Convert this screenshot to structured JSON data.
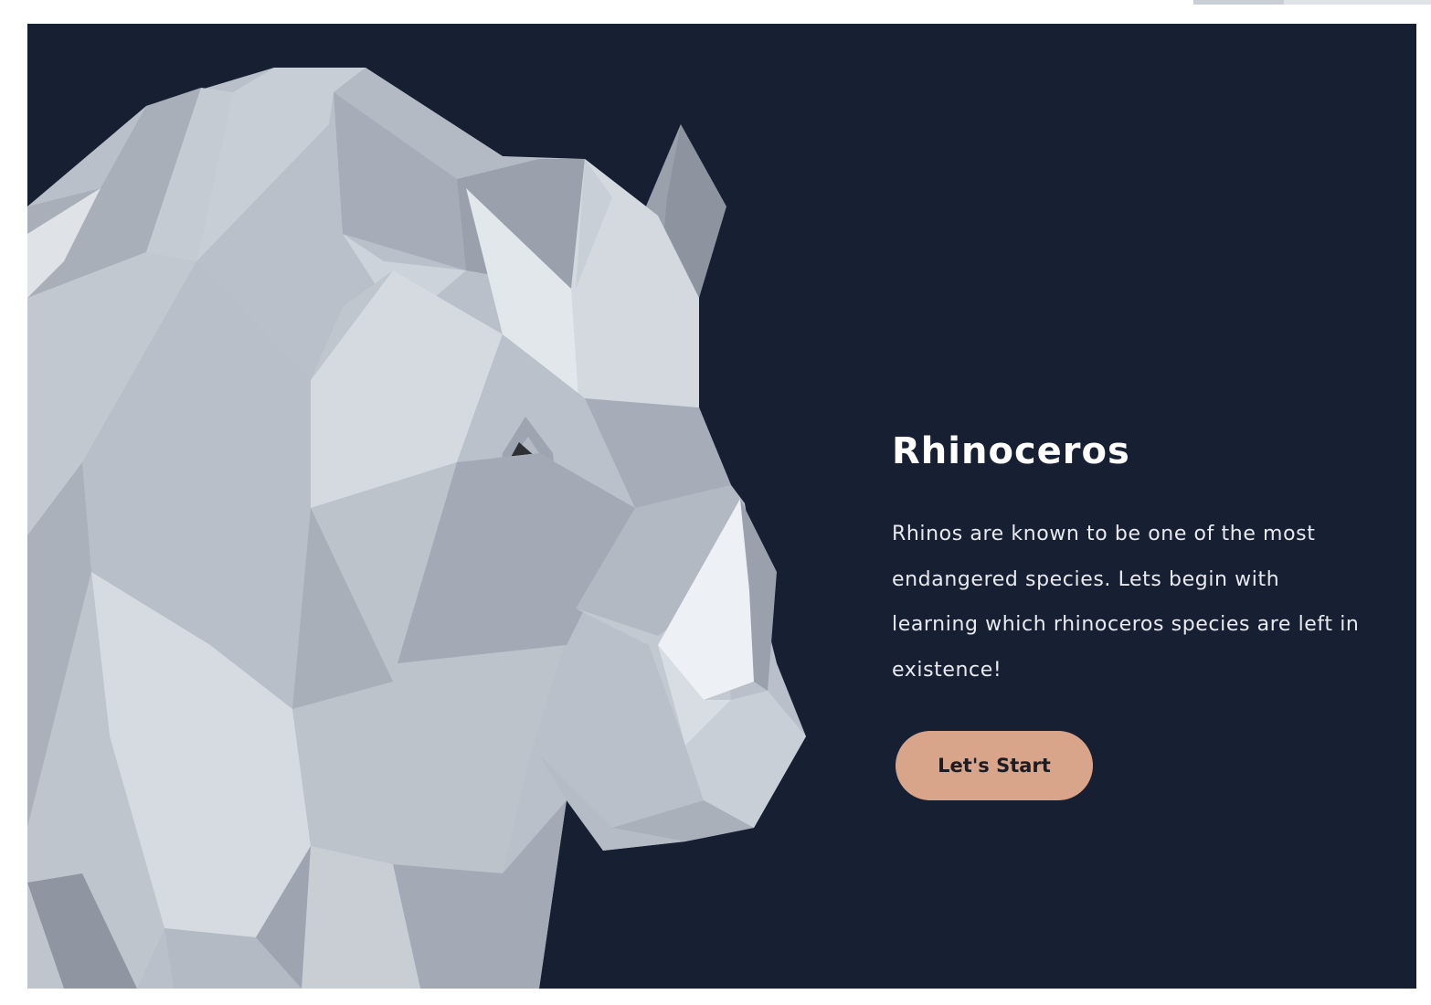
{
  "hero": {
    "title": "Rhinoceros",
    "description": "Rhinos are known to be one of the most endangered species. Lets begin with learning which rhinoceros species are left in existence!",
    "cta_label": "Let's Start"
  },
  "colors": {
    "background": "#172033",
    "title": "#ffffff",
    "description": "#e8eaef",
    "button": "#d8a58b",
    "button_text": "#1c1c22"
  },
  "illustration": {
    "subject": "low-poly rhinoceros head"
  }
}
